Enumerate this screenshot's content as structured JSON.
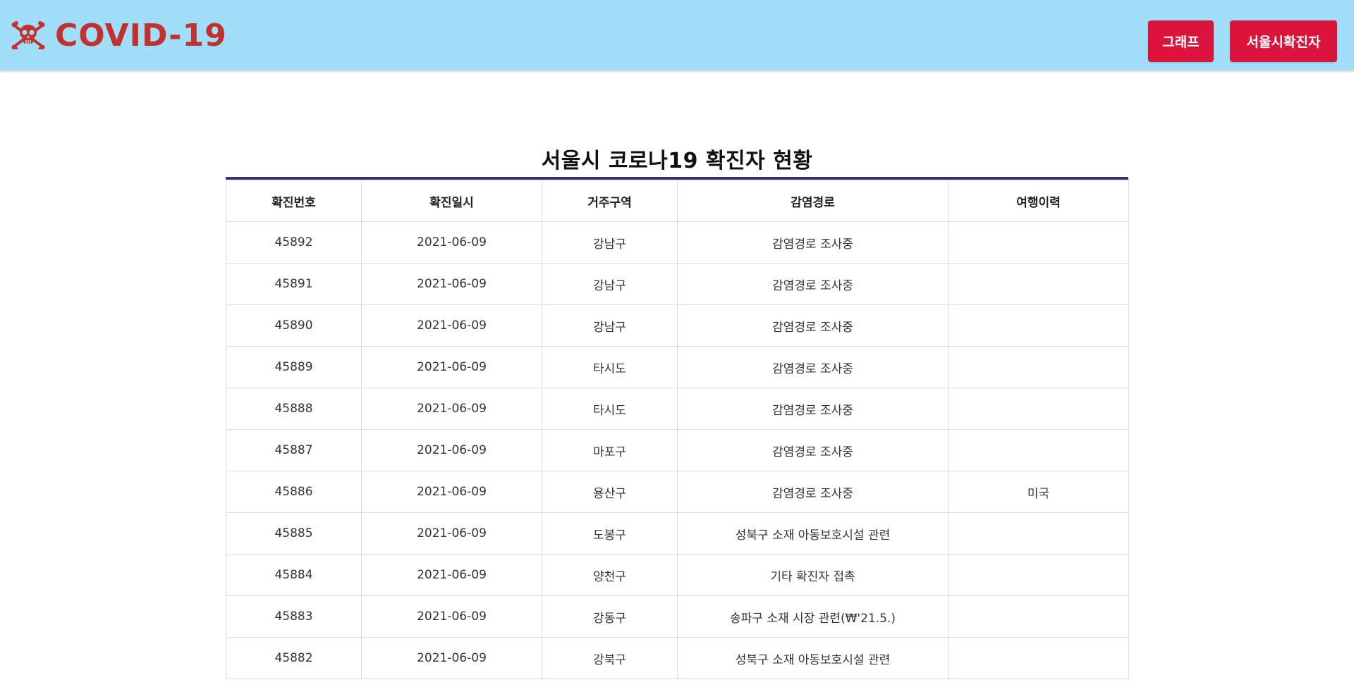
{
  "header": {
    "logo_text": "COVID-19",
    "logo_icon": "skull-crossbones-icon",
    "nav": {
      "graph_label": "그래프",
      "seoul_label": "서울시확진자"
    },
    "colors": {
      "background": "#a0defa",
      "logo": "#c3312e",
      "button": "#dc143c"
    }
  },
  "main": {
    "title": "서울시 코로나19 확진자 현황",
    "table": {
      "columns": [
        "확진번호",
        "확진일시",
        "거주구역",
        "감염경로",
        "여행이력"
      ],
      "rows": [
        [
          "45892",
          "2021-06-09",
          "강남구",
          "감염경로 조사중",
          ""
        ],
        [
          "45891",
          "2021-06-09",
          "강남구",
          "감염경로 조사중",
          ""
        ],
        [
          "45890",
          "2021-06-09",
          "강남구",
          "감염경로 조사중",
          ""
        ],
        [
          "45889",
          "2021-06-09",
          "타시도",
          "감염경로 조사중",
          ""
        ],
        [
          "45888",
          "2021-06-09",
          "타시도",
          "감염경로 조사중",
          ""
        ],
        [
          "45887",
          "2021-06-09",
          "마포구",
          "감염경로 조사중",
          ""
        ],
        [
          "45886",
          "2021-06-09",
          "용산구",
          "감염경로 조사중",
          "미국"
        ],
        [
          "45885",
          "2021-06-09",
          "도봉구",
          "성북구 소재 아동보호시설 관련",
          ""
        ],
        [
          "45884",
          "2021-06-09",
          "양천구",
          "기타 확진자 접촉",
          ""
        ],
        [
          "45883",
          "2021-06-09",
          "강동구",
          "송파구 소재 시장 관련(₩'21.5.)",
          ""
        ],
        [
          "45882",
          "2021-06-09",
          "강북구",
          "성북구 소재 아동보호시설 관련",
          ""
        ]
      ]
    }
  }
}
